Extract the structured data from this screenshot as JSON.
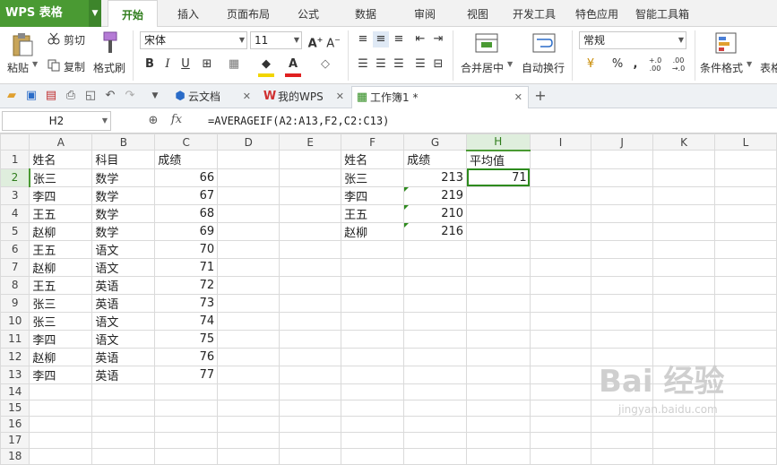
{
  "app": {
    "logo": "WPS 表格"
  },
  "menu": {
    "tabs": [
      "开始",
      "插入",
      "页面布局",
      "公式",
      "数据",
      "审阅",
      "视图",
      "开发工具",
      "特色应用",
      "智能工具箱"
    ],
    "active": "开始"
  },
  "ribbon": {
    "paste": "粘贴",
    "cut": "剪切",
    "copy": "复制",
    "format_painter": "格式刷",
    "font_name": "宋体",
    "font_size": "11",
    "merge_center": "合并居中",
    "wrap_text": "自动换行",
    "number_format": "常规",
    "conditional_format": "条件格式",
    "table_style": "表格"
  },
  "doc_tabs": [
    {
      "label": "云文档"
    },
    {
      "label": "我的WPS"
    },
    {
      "label": "工作簿1 *"
    }
  ],
  "formula_bar": {
    "name_box": "H2",
    "fx": "fx",
    "formula": "=AVERAGEIF(A2:A13,F2,C2:C13)"
  },
  "sheet": {
    "columns": [
      "A",
      "B",
      "C",
      "D",
      "E",
      "F",
      "G",
      "H",
      "I",
      "J",
      "K",
      "L"
    ],
    "rows": [
      "1",
      "2",
      "3",
      "4",
      "5",
      "6",
      "7",
      "8",
      "9",
      "10",
      "11",
      "12",
      "13",
      "14",
      "15",
      "16",
      "17",
      "18"
    ],
    "cells": {
      "A1": "姓名",
      "B1": "科目",
      "C1": "成绩",
      "A2": "张三",
      "B2": "数学",
      "C2": "66",
      "A3": "李四",
      "B3": "数学",
      "C3": "67",
      "A4": "王五",
      "B4": "数学",
      "C4": "68",
      "A5": "赵柳",
      "B5": "数学",
      "C5": "69",
      "A6": "王五",
      "B6": "语文",
      "C6": "70",
      "A7": "赵柳",
      "B7": "语文",
      "C7": "71",
      "A8": "王五",
      "B8": "英语",
      "C8": "72",
      "A9": "张三",
      "B9": "英语",
      "C9": "73",
      "A10": "张三",
      "B10": "语文",
      "C10": "74",
      "A11": "李四",
      "B11": "语文",
      "C11": "75",
      "A12": "赵柳",
      "B12": "英语",
      "C12": "76",
      "A13": "李四",
      "B13": "英语",
      "C13": "77",
      "F1": "姓名",
      "G1": "成绩",
      "H1": "平均值",
      "F2": "张三",
      "G2": "213",
      "H2": "71",
      "F3": "李四",
      "G3": "219",
      "F4": "王五",
      "G4": "210",
      "F5": "赵柳",
      "G5": "216"
    },
    "active_cell": "H2"
  },
  "watermark": {
    "main": "Bai 经验",
    "sub": "jingyan.baidu.com"
  }
}
